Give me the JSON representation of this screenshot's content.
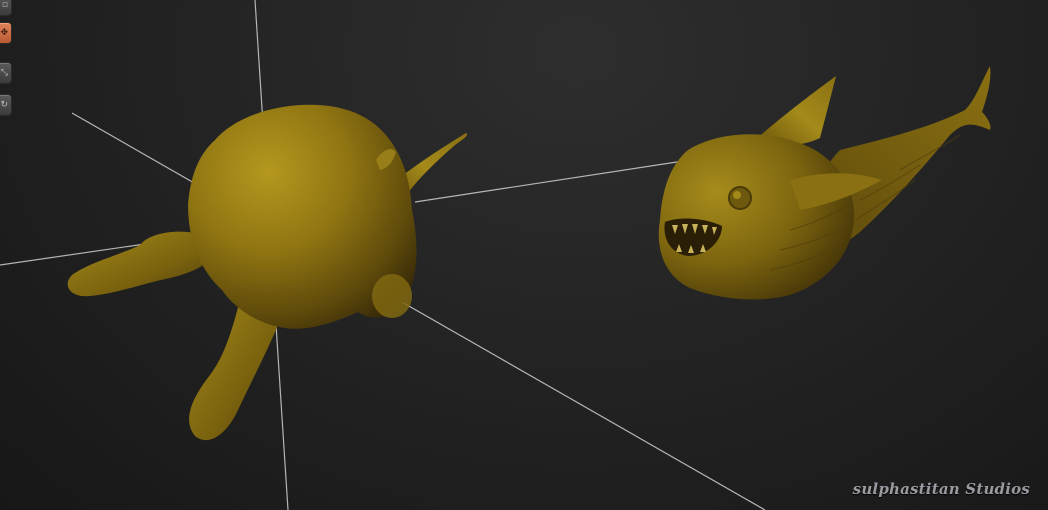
{
  "toolbar": {
    "buttons": [
      {
        "icon": "square-icon",
        "glyph": "▫",
        "active": false
      },
      {
        "icon": "move-icon",
        "glyph": "✥",
        "active": true
      },
      {
        "icon": "scale-icon",
        "glyph": "⤡",
        "active": false
      },
      {
        "icon": "rotate-icon",
        "glyph": "↻",
        "active": false
      }
    ]
  },
  "viewport": {
    "background": "#1e1e1e",
    "model_color": "#8f7412",
    "grid_line_color": "#d0d0d0"
  },
  "watermark": {
    "text": "sulphastitan Studios"
  }
}
